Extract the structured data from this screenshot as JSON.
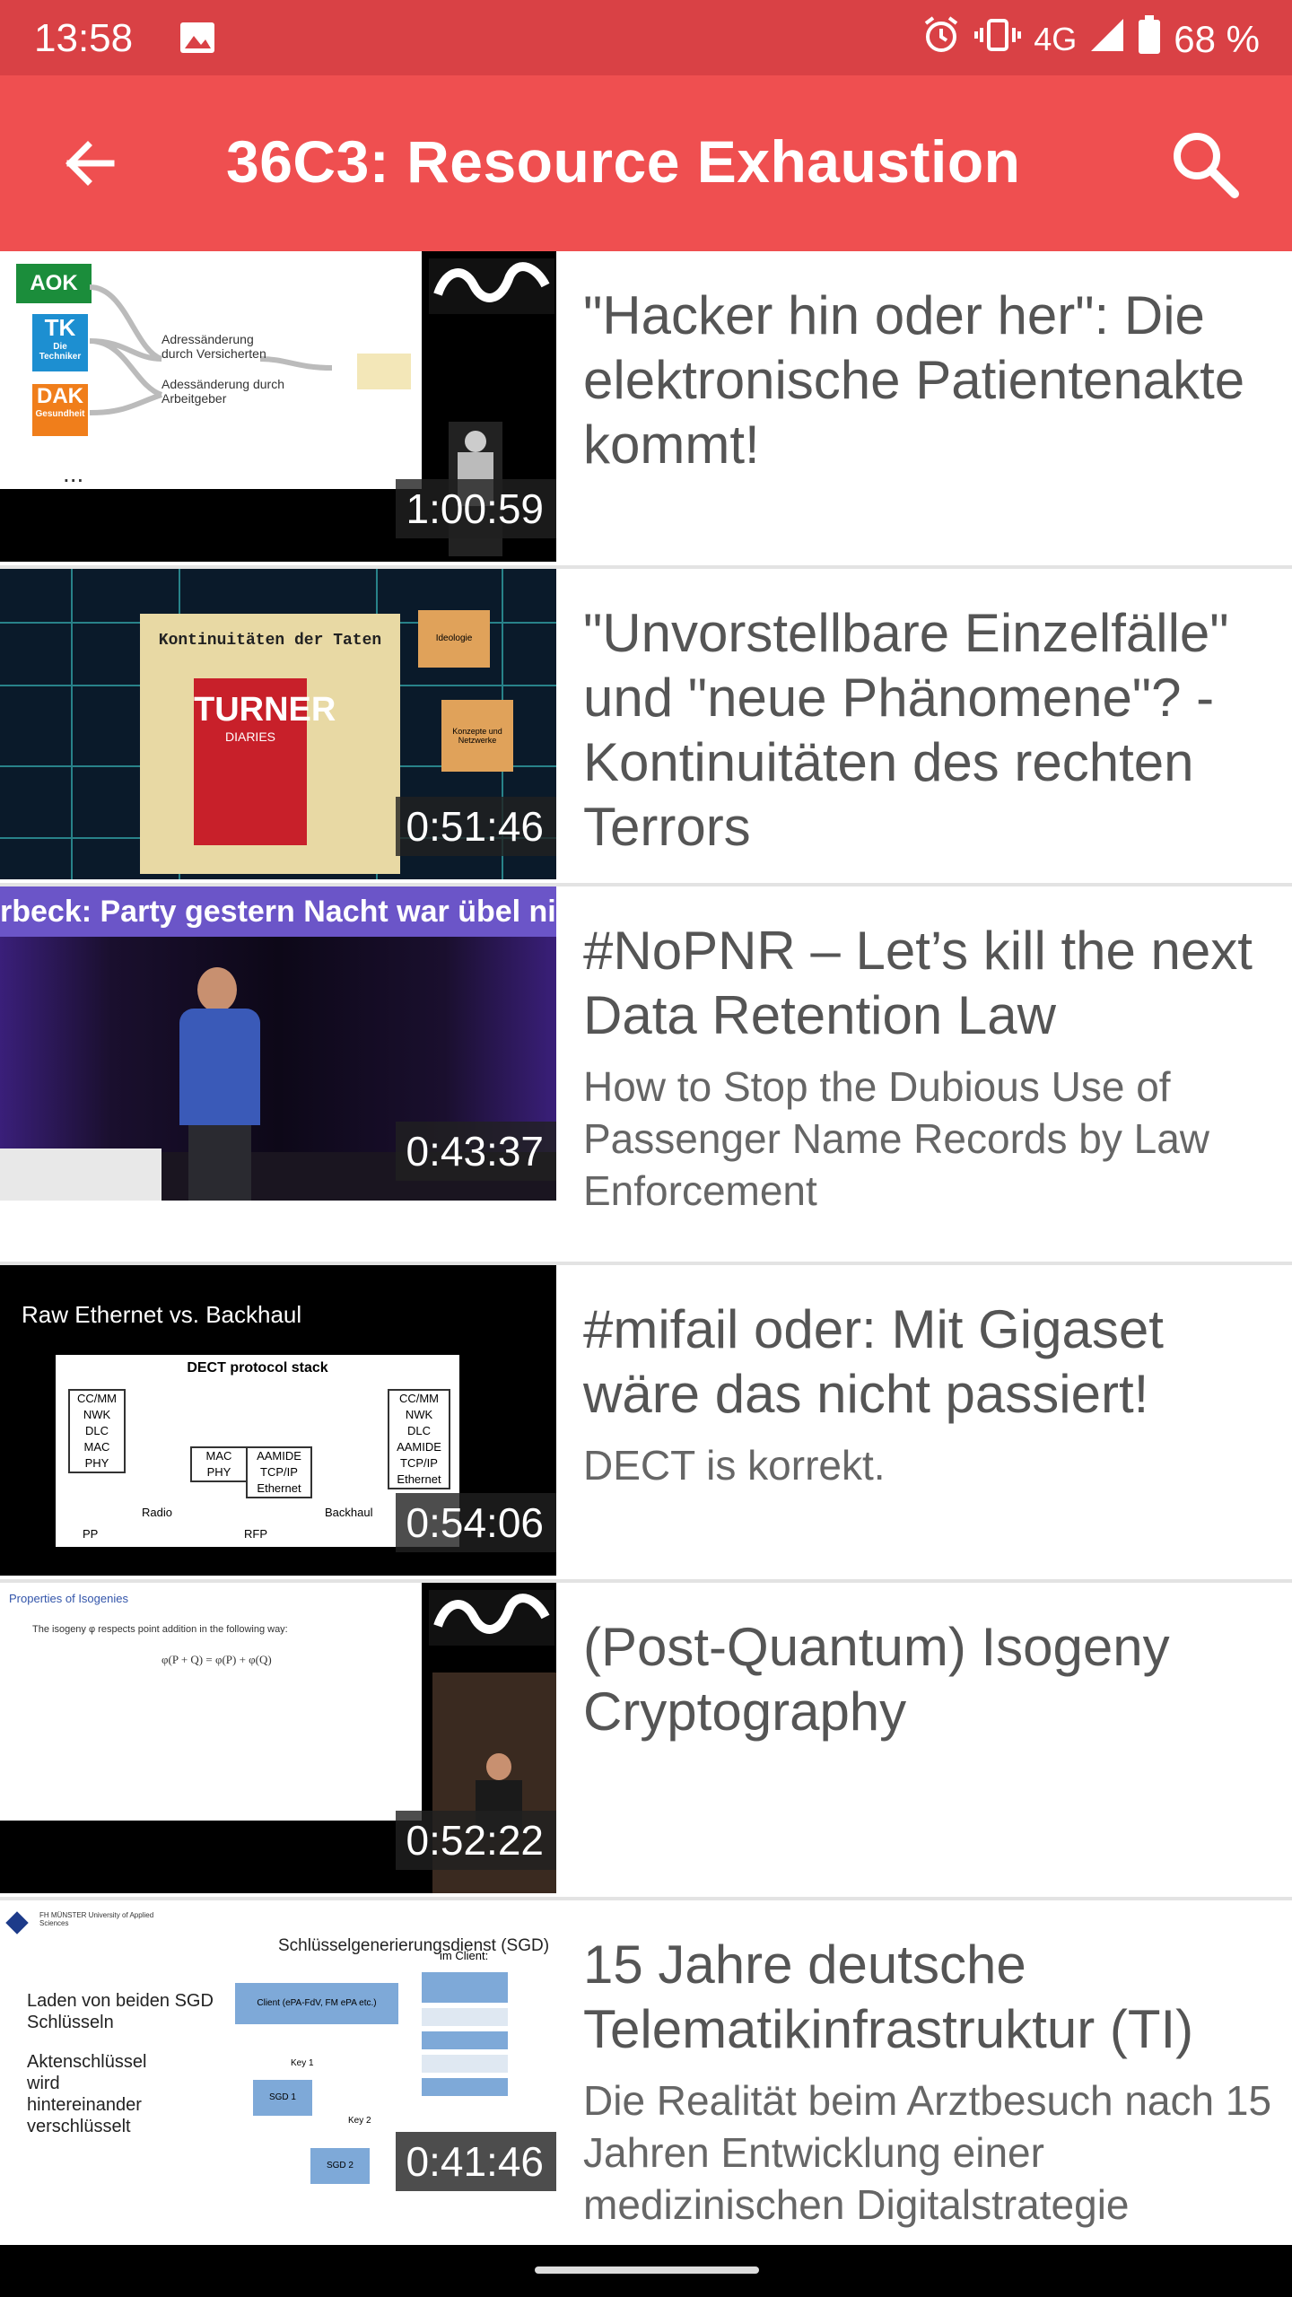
{
  "status": {
    "time": "13:58",
    "network": "4G",
    "battery": "68 %"
  },
  "app_bar": {
    "title": "36C3: Resource Exhaustion"
  },
  "items": [
    {
      "title": "\"Hacker hin oder her\": Die elektronische Patientenakte kommt!",
      "subtitle": "",
      "duration": "1:00:59"
    },
    {
      "title": "\"Unvorstellbare Einzelfälle\" und \"neue Phänomene\"? - Kontinuitäten des rechten Terrors",
      "subtitle": "",
      "duration": "0:51:46"
    },
    {
      "title": "#NoPNR – Let’s kill the next Data Retention Law",
      "subtitle": "How to Stop the Dubious Use of Passenger Name Records by Law Enforcement",
      "duration": "0:43:37"
    },
    {
      "title": "#mifail oder: Mit Gigaset wäre das nicht passiert!",
      "subtitle": "DECT is korrekt.",
      "duration": "0:54:06"
    },
    {
      "title": "(Post-Quantum) Isogeny Cryptography",
      "subtitle": "",
      "duration": "0:52:22"
    },
    {
      "title": "15 Jahre deutsche Telematikinfrastruktur (TI)",
      "subtitle": "Die Realität beim Arztbesuch nach 15 Jahren Entwicklung einer medizinischen Digitalstrategie",
      "duration": "0:41:46"
    }
  ],
  "thumbs": {
    "t1": {
      "aok": "AOK",
      "tk": "TK",
      "tk_sub": "Die Techniker",
      "dak": "DAK",
      "dak_sub": "Gesundheit",
      "label1": "Adressänderung durch Versicherten",
      "label2": "Adessänderung durch Arbeitgeber",
      "ellipsis": "..."
    },
    "t2": {
      "box_title": "Kontinuitäten der Taten",
      "book_title": "TURNER",
      "book_sub": "DIARIES",
      "box_small1": "Ideologie",
      "box_small2": "Konzepte und Netzwerke"
    },
    "t3": {
      "banner": "rbeck: Party gestern Nacht war übel nice"
    },
    "t4": {
      "heading": "Raw Ethernet vs. Backhaul",
      "stack_title": "DECT protocol stack",
      "left_stack": [
        "CC/MM",
        "NWK",
        "DLC",
        "MAC",
        "PHY"
      ],
      "mid_stack": [
        "MAC",
        "PHY"
      ],
      "mid_stack2": [
        "AAMIDE",
        "TCP/IP",
        "Ethernet"
      ],
      "right_stack": [
        "CC/MM",
        "NWK",
        "DLC",
        "AAMIDE",
        "TCP/IP",
        "Ethernet"
      ],
      "label_radio": "Radio",
      "label_backhaul": "Backhaul",
      "label_pp": "PP",
      "label_rfp": "RFP"
    },
    "t5": {
      "heading": "Properties of Isogenies",
      "bullet": "The isogeny φ respects point addition in the following way:",
      "formula": "φ(P + Q) = φ(P) + φ(Q)"
    },
    "t6": {
      "univ": "FH MÜNSTER University of Applied Sciences",
      "heading": "Schlüsselgenerierungsdienst (SGD)",
      "bullet1": "Laden von beiden SGD Schlüsseln",
      "bullet2": "Aktenschlüssel wird hintereinander verschlüsselt",
      "client": "Client (ePA-FdV, FM ePA etc.)",
      "sgd1": "SGD 1",
      "sgd2": "SGD 2",
      "key1": "Key 1",
      "key2": "Key 2",
      "im_client": "im Client:"
    }
  }
}
